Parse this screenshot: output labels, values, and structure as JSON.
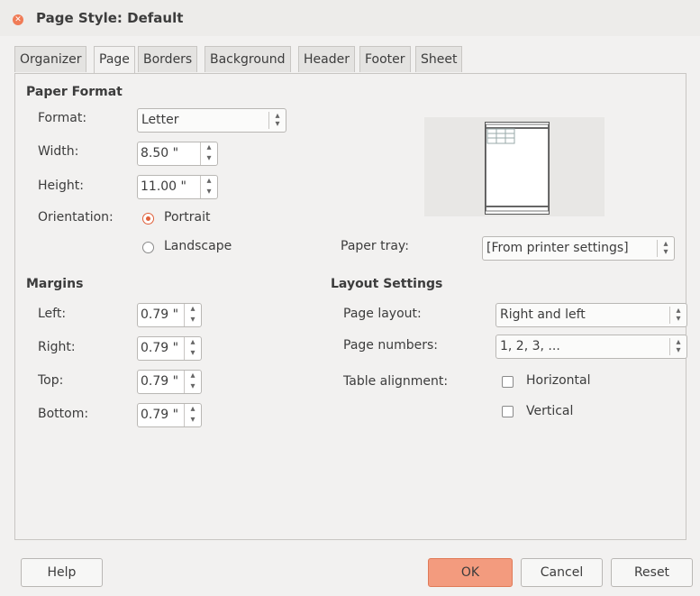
{
  "window": {
    "title": "Page Style: Default"
  },
  "tabs": [
    {
      "label": "Organizer"
    },
    {
      "label": "Page"
    },
    {
      "label": "Borders"
    },
    {
      "label": "Background"
    },
    {
      "label": "Header"
    },
    {
      "label": "Footer"
    },
    {
      "label": "Sheet"
    }
  ],
  "active_tab": "Page",
  "paper_format": {
    "heading": "Paper Format",
    "format_label": "Format:",
    "format_value": "Letter",
    "width_label": "Width:",
    "width_value": "8.50 \"",
    "height_label": "Height:",
    "height_value": "11.00 \"",
    "orientation_label": "Orientation:",
    "portrait_label": "Portrait",
    "landscape_label": "Landscape",
    "orientation_selected": "Portrait",
    "paper_tray_label": "Paper tray:",
    "paper_tray_value": "[From printer settings]"
  },
  "margins": {
    "heading": "Margins",
    "left_label": "Left:",
    "left_value": "0.79 \"",
    "right_label": "Right:",
    "right_value": "0.79 \"",
    "top_label": "Top:",
    "top_value": "0.79 \"",
    "bottom_label": "Bottom:",
    "bottom_value": "0.79 \""
  },
  "layout": {
    "heading": "Layout Settings",
    "page_layout_label": "Page layout:",
    "page_layout_value": "Right and left",
    "page_numbers_label": "Page numbers:",
    "page_numbers_value": "1, 2, 3, ...",
    "table_alignment_label": "Table alignment:",
    "horizontal_label": "Horizontal",
    "vertical_label": "Vertical",
    "horizontal_checked": false,
    "vertical_checked": false
  },
  "buttons": {
    "help": "Help",
    "ok": "OK",
    "cancel": "Cancel",
    "reset": "Reset"
  },
  "colors": {
    "accent": "#e0603a",
    "ok_button": "#f39b7e",
    "close": "#f07b56"
  },
  "icons": {
    "close": "close-icon",
    "spin": "spin-arrows-icon",
    "combo": "combo-arrows-icon"
  }
}
